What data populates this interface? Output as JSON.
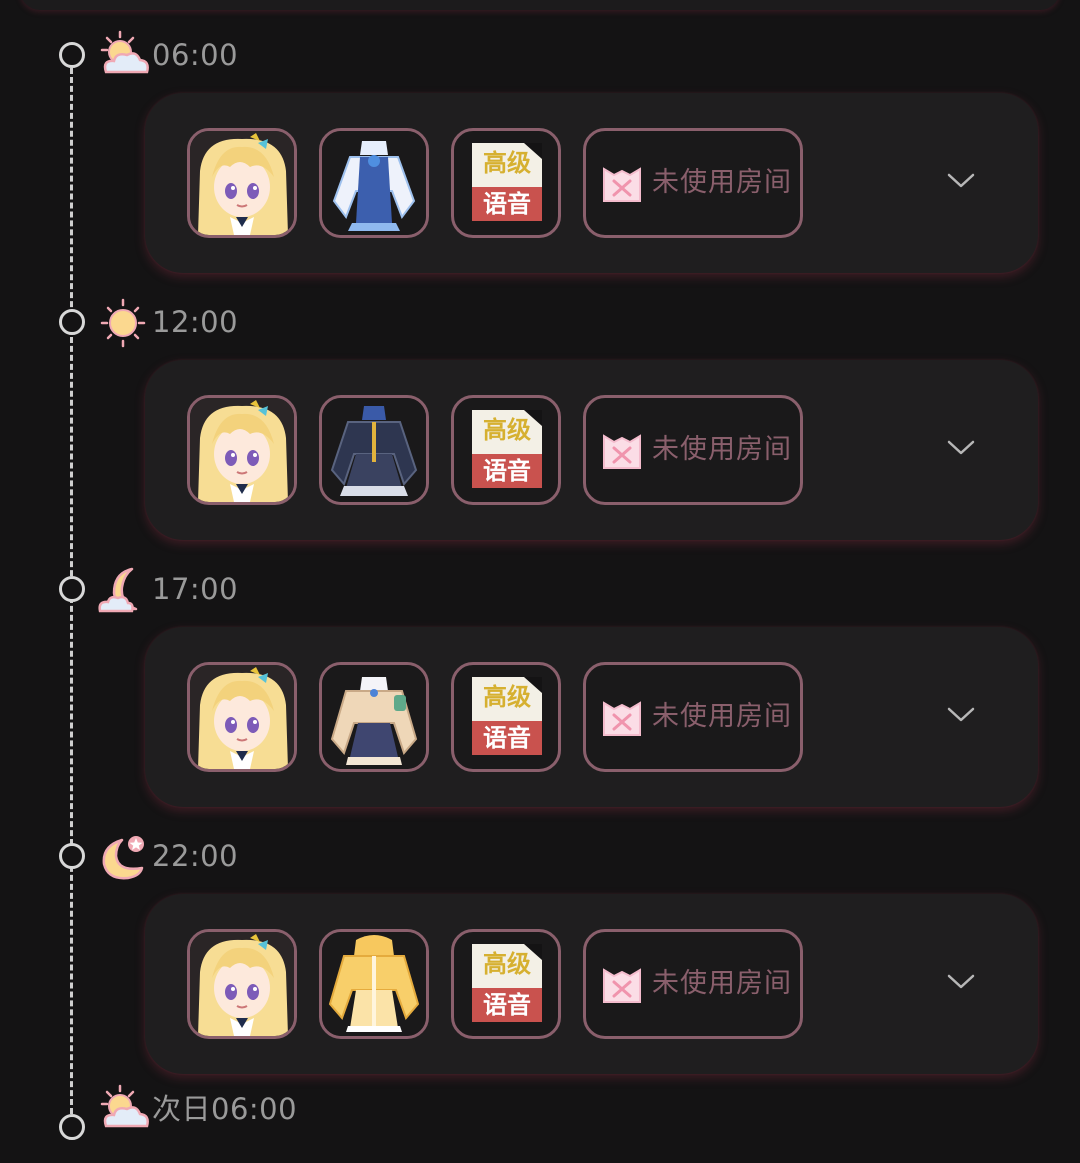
{
  "timeline": {
    "entries": [
      {
        "time": "06:00",
        "time_icon": "sun-cloud-icon",
        "card": {
          "character_icon": "blonde-girl-avatar",
          "outfit_icon": "white-blue-dress-outfit",
          "voice": {
            "top": "高级",
            "bottom": "语音"
          },
          "room_label": "未使用房间",
          "expand_icon": "chevron-down-icon"
        }
      },
      {
        "time": "12:00",
        "time_icon": "sun-icon",
        "card": {
          "character_icon": "blonde-girl-avatar",
          "outfit_icon": "navy-uniform-outfit",
          "voice": {
            "top": "高级",
            "bottom": "语音"
          },
          "room_label": "未使用房间",
          "expand_icon": "chevron-down-icon"
        }
      },
      {
        "time": "17:00",
        "time_icon": "moon-cloud-icon",
        "card": {
          "character_icon": "blonde-girl-avatar",
          "outfit_icon": "beige-cardigan-outfit",
          "voice": {
            "top": "高级",
            "bottom": "语音"
          },
          "room_label": "未使用房间",
          "expand_icon": "chevron-down-icon"
        }
      },
      {
        "time": "22:00",
        "time_icon": "moon-star-icon",
        "card": {
          "character_icon": "blonde-girl-avatar",
          "outfit_icon": "yellow-hoodie-outfit",
          "voice": {
            "top": "高级",
            "bottom": "语音"
          },
          "room_label": "未使用房间",
          "expand_icon": "chevron-down-icon"
        }
      }
    ],
    "final": {
      "time": "次日06:00",
      "time_icon": "sun-cloud-icon"
    }
  },
  "colors": {
    "background": "#141314",
    "card": "#1f1e1f",
    "slot_border": "#8a5f6c",
    "time_text": "#9a9a9a",
    "voice_gold": "#d6b030",
    "voice_red": "#c9524e"
  }
}
